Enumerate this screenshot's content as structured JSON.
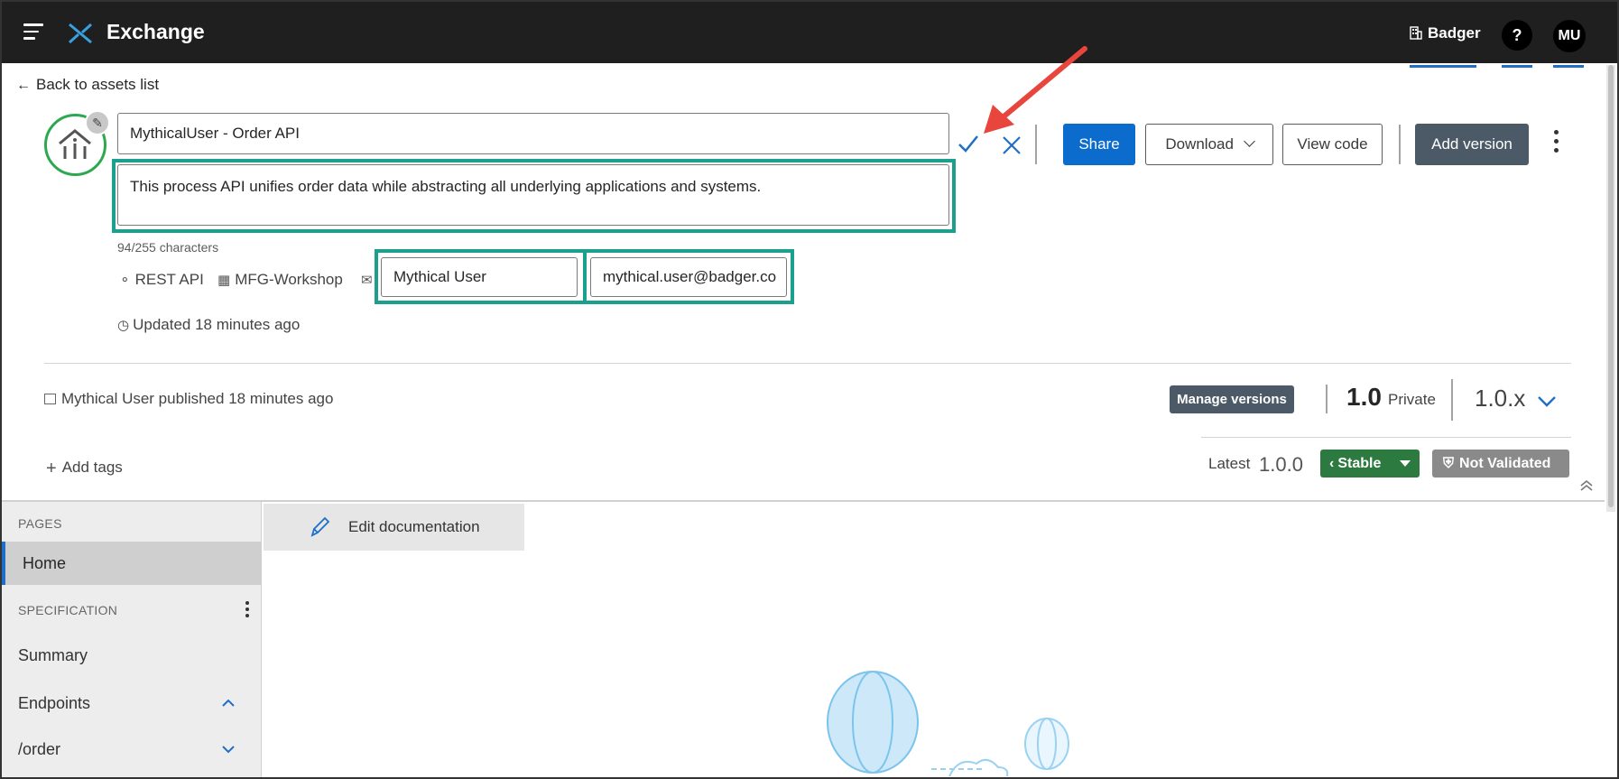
{
  "topbar": {
    "brand": "Exchange",
    "org_name": "Badger",
    "help_label": "?",
    "avatar_initials": "MU"
  },
  "back_link": "Back to assets list",
  "asset": {
    "title": "MythicalUser - Order API",
    "description": "This process API unifies order data while abstracting all underlying applications and systems.",
    "char_count": "94/255 characters",
    "type": "REST API",
    "business_group": "MFG-Workshop",
    "contact_name": "Mythical User",
    "contact_email": "mythical.user@badger.co",
    "updated": "Updated 18 minutes ago",
    "published": "Mythical User published 18 minutes ago"
  },
  "actions": {
    "share": "Share",
    "download": "Download",
    "view_code": "View code",
    "add_version": "Add version"
  },
  "versions": {
    "manage_label": "Manage versions",
    "current": "1.0",
    "visibility": "Private",
    "selected": "1.0.x",
    "latest_label": "Latest",
    "latest_version": "1.0.0",
    "lifecycle": "Stable",
    "validation": "Not Validated"
  },
  "tags": {
    "add_label": "Add tags"
  },
  "sidebar": {
    "pages_heading": "PAGES",
    "home": "Home",
    "spec_heading": "SPECIFICATION",
    "summary": "Summary",
    "endpoints": "Endpoints",
    "order": "/order"
  },
  "edit_documentation": "Edit documentation",
  "colors": {
    "accent": "#0b6ccd",
    "highlight": "#1aa08d",
    "stable": "#2c7a3f",
    "annotation": "#e8453c"
  }
}
